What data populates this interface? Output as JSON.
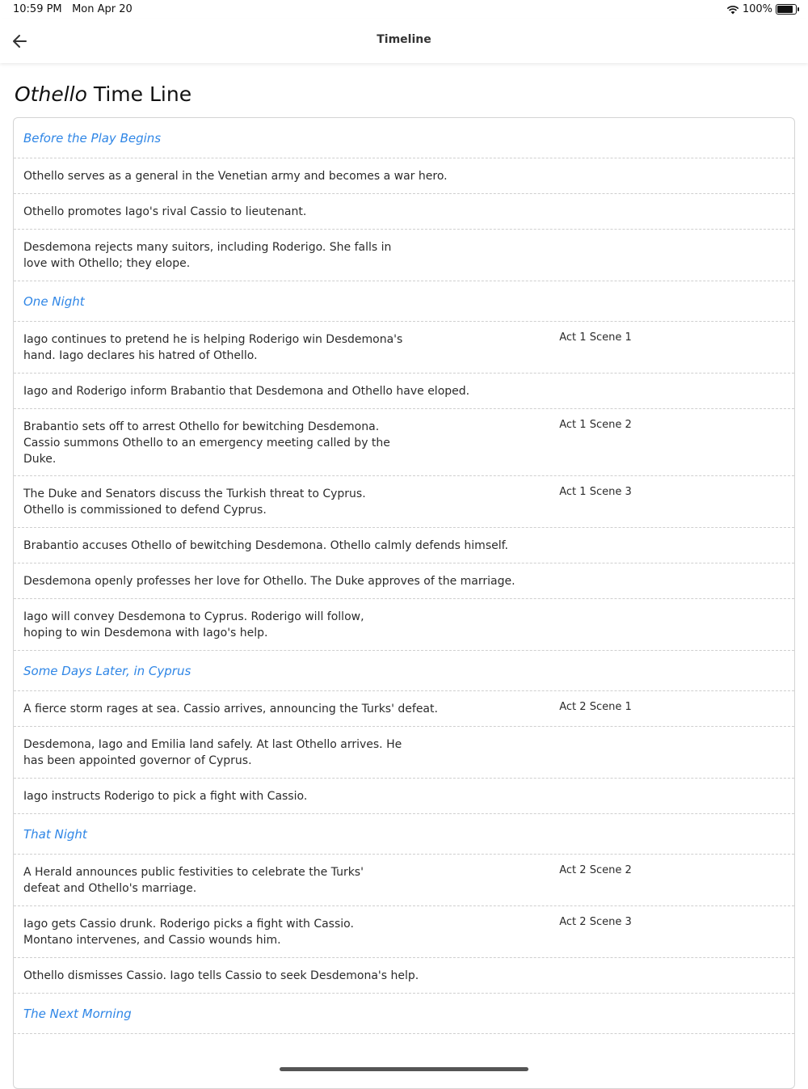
{
  "status": {
    "time": "10:59 PM",
    "date": "Mon Apr 20",
    "battery": "100%",
    "battery_level": 1.0
  },
  "nav": {
    "title": "Timeline"
  },
  "page": {
    "title_italic": "Othello",
    "title_rest": " Time Line"
  },
  "sections": [
    {
      "label": "Before the Play Begins",
      "events": [
        {
          "desc": "Othello serves as a general in the Venetian army and becomes a war hero.",
          "scene": ""
        },
        {
          "desc": "Othello promotes Iago's rival Cassio to lieutenant.",
          "scene": ""
        },
        {
          "desc": "Desdemona rejects many suitors, including Roderigo. She falls in love with Othello; they elope.",
          "scene": ""
        }
      ]
    },
    {
      "label": "One Night",
      "events": [
        {
          "desc": "Iago continues to pretend he is helping Roderigo win Desdemona's hand. Iago declares his hatred of Othello.",
          "scene": "Act 1 Scene 1"
        },
        {
          "desc": "Iago and Roderigo inform Brabantio that Desdemona and Othello have eloped.",
          "scene": ""
        },
        {
          "desc": "Brabantio sets off to arrest Othello for bewitching Desdemona. Cassio summons Othello to an emergency meeting called by the Duke.",
          "scene": "Act 1 Scene 2"
        },
        {
          "desc": "The Duke and Senators discuss the Turkish threat to Cyprus. Othello is commissioned to defend Cyprus.",
          "scene": "Act 1 Scene 3"
        },
        {
          "desc": "Brabantio accuses Othello of bewitching Desdemona. Othello calmly defends himself.",
          "scene": ""
        },
        {
          "desc": "Desdemona openly professes her love for Othello. The Duke approves of the marriage.",
          "scene": ""
        },
        {
          "desc": "Iago will convey Desdemona to Cyprus. Roderigo will follow, hoping to win Desdemona with Iago's help.",
          "scene": ""
        }
      ]
    },
    {
      "label": "Some Days Later, in Cyprus",
      "events": [
        {
          "desc": "A fierce storm rages at sea. Cassio arrives, announcing the Turks' defeat.",
          "scene": "Act 2 Scene 1"
        },
        {
          "desc": "Desdemona, Iago and Emilia land safely. At last Othello arrives. He has been appointed governor of Cyprus.",
          "scene": ""
        },
        {
          "desc": "Iago instructs Roderigo to pick a fight with Cassio.",
          "scene": ""
        }
      ]
    },
    {
      "label": "That Night",
      "events": [
        {
          "desc": "A Herald announces public festivities to celebrate the Turks' defeat and Othello's marriage.",
          "scene": "Act 2 Scene 2"
        },
        {
          "desc": "Iago gets Cassio drunk. Roderigo picks a fight with Cassio. Montano intervenes, and Cassio wounds him.",
          "scene": "Act 2 Scene 3"
        },
        {
          "desc": "Othello dismisses Cassio. Iago tells Cassio to seek Desdemona's help.",
          "scene": ""
        }
      ]
    },
    {
      "label": "The Next Morning",
      "events": []
    }
  ],
  "colors": {
    "section": "#2f86e6"
  }
}
